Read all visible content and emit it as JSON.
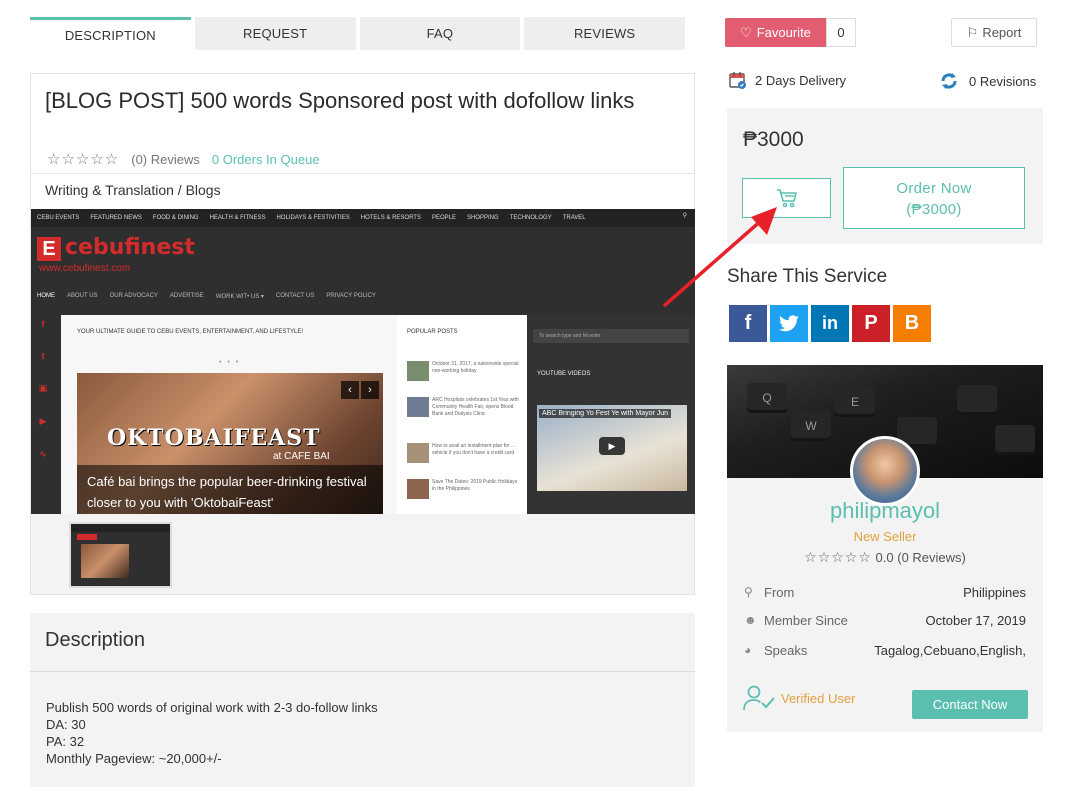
{
  "tabs": [
    {
      "label": "DESCRIPTION"
    },
    {
      "label": "REQUEST"
    },
    {
      "label": "FAQ"
    },
    {
      "label": "REVIEWS"
    }
  ],
  "service": {
    "title": "[BLOG POST] 500 words Sponsored post with dofollow links",
    "stars": "☆☆☆☆☆",
    "reviews": "(0) Reviews",
    "orders_in_queue": "0 Orders In Queue",
    "category": "Writing & Translation / Blogs"
  },
  "preview": {
    "top_nav": [
      "CEBU EVENTS",
      "FEATURED NEWS",
      "FOOD & DINING",
      "HEALTH & FITNESS",
      "HOLIDAYS & FESTIVITIES",
      "HOTELS & RESORTS",
      "PEOPLE",
      "SHOPPING",
      "TECHNOLOGY",
      "TRAVEL"
    ],
    "logo_text": "cebufinest",
    "logo_url": "www.cebufinest.com",
    "sub_nav": [
      "HOME",
      "ABOUT US",
      "OUR ADVOCACY",
      "ADVERTISE",
      "WORK WIT• US ▾",
      "CONTACT US",
      "PRIVACY POLICY"
    ],
    "guide_text": "YOUR ULTIMATE GUIDE TO CEBU EVENTS, ENTERTAINMENT, AND LIFESTYLE!",
    "feature_title": "OKTOBAIFEAST",
    "feature_sub": "at CAFE BAI",
    "feature_caption": "Café bai brings the popular beer-drinking festival closer to you with 'OktobaiFeast'",
    "popular_title": "POPULAR POSTS",
    "popular_posts": [
      "October 31, 2017, a nationwide special non-working holiday",
      "ARC Hospitals celebrates 1st Year with Community Health Fair, opens Blood Bank and Dialysis Clinic",
      "How to avail an installment plan for ... vehicle if you don't have a credit card",
      "Save The Dates: 2019 Public Holidays in the Philippines"
    ],
    "search_placeholder": "To search type and hit enter",
    "youtube_title": "YOUTUBE VIDEOS",
    "video_title": "ABC Bringing Yo Fest Ye with Mayor Jun"
  },
  "description": {
    "heading": "Description",
    "lines": [
      "Publish 500 words of original work with 2-3 do-follow links",
      "DA: 30",
      "PA: 32",
      "Monthly Pageview: ~20,000+/-"
    ]
  },
  "actions": {
    "favourite_label": "Favourite",
    "favourite_count": "0",
    "report_label": "Report"
  },
  "delivery": {
    "days": "2 Days Delivery",
    "revisions": "0 Revisions"
  },
  "pricing": {
    "price": "₱3000",
    "order_line1": "Order Now",
    "order_line2": "(₱3000)"
  },
  "share": {
    "title": "Share This Service",
    "networks": [
      {
        "name": "facebook",
        "glyph": "f",
        "color": "#3b5998"
      },
      {
        "name": "twitter",
        "glyph": "t",
        "color": "#1da1f2"
      },
      {
        "name": "linkedin",
        "glyph": "in",
        "color": "#0077b5"
      },
      {
        "name": "pinterest",
        "glyph": "P",
        "color": "#cb2027"
      },
      {
        "name": "blogger",
        "glyph": "B",
        "color": "#f57d00"
      }
    ]
  },
  "seller": {
    "name": "philipmayol",
    "level": "New Seller",
    "stars": "☆☆☆☆☆",
    "rating": "0.0",
    "reviews": "(0 Reviews)",
    "from_label": "From",
    "from_value": "Philippines",
    "member_label": "Member Since",
    "member_value": "October 17, 2019",
    "speaks_label": "Speaks",
    "speaks_value": "Tagalog,Cebuano,English,",
    "verified_label": "Verified User",
    "contact_label": "Contact Now"
  },
  "colors": {
    "accent": "#5bbfb0",
    "favourite": "#e35d72",
    "seller_level": "#e0a23c",
    "annotation_arrow": "#e8202a"
  }
}
